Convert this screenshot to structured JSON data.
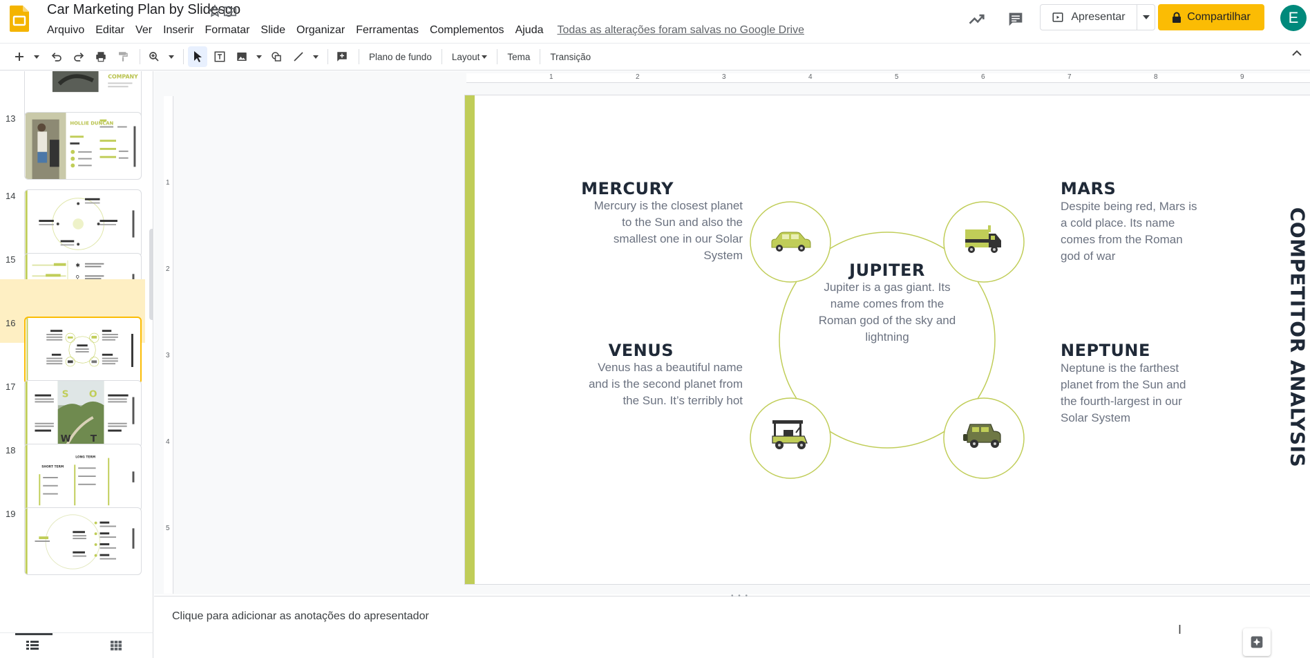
{
  "app": {
    "doc_title": "Car Marketing Plan by Slidesgo",
    "avatar_letter": "E",
    "brand_color": "#fbbc04"
  },
  "menu": [
    "Arquivo",
    "Editar",
    "Ver",
    "Inserir",
    "Formatar",
    "Slide",
    "Organizar",
    "Ferramentas",
    "Complementos",
    "Ajuda"
  ],
  "saved_status": "Todas as alterações foram salvas no Google Drive",
  "header": {
    "present_label": "Apresentar",
    "share_label": "Compartilhar"
  },
  "toolbar": {
    "background_label": "Plano de fundo",
    "layout_label": "Layout",
    "theme_label": "Tema",
    "transition_label": "Transição"
  },
  "filmstrip": {
    "slides": [
      {
        "num": "13"
      },
      {
        "num": "14"
      },
      {
        "num": "15"
      },
      {
        "num": "16",
        "selected": true
      },
      {
        "num": "17"
      },
      {
        "num": "18"
      },
      {
        "num": "19"
      }
    ]
  },
  "rulers": {
    "h": [
      "1",
      "2",
      "3",
      "4",
      "5",
      "6",
      "7",
      "8",
      "9"
    ],
    "v": [
      "1",
      "2",
      "3",
      "4",
      "5"
    ]
  },
  "slide": {
    "side_title": "COMPETITOR ANALYSIS",
    "accent_color": "#c0cd58",
    "mercury": {
      "title": "MERCURY",
      "desc": "Mercury is the closest planet to the Sun and also the smallest one in our Solar System"
    },
    "mars": {
      "title": "MARS",
      "desc": "Despite being red, Mars is a cold place. Its name comes from the Roman god of war"
    },
    "jupiter": {
      "title": "JUPITER",
      "desc": "Jupiter is a gas giant. Its name comes from the Roman god of the sky and lightning"
    },
    "venus": {
      "title": "VENUS",
      "desc": "Venus has a beautiful name and is the second planet from the Sun. It’s terribly hot"
    },
    "neptune": {
      "title": "NEPTUNE",
      "desc": "Neptune is the farthest planet from the Sun and the fourth-largest in our Solar System"
    }
  },
  "notes": {
    "placeholder": "Clique para adicionar as anotações do apresentador"
  },
  "thumb_text": {
    "s12_company": "COMPANY",
    "s13_name": "HOLLIE DUNCAN",
    "s17_letters": [
      "S",
      "O",
      "W",
      "T"
    ],
    "s18_labels": [
      "SHORT TERM",
      "LONG TERM"
    ]
  }
}
